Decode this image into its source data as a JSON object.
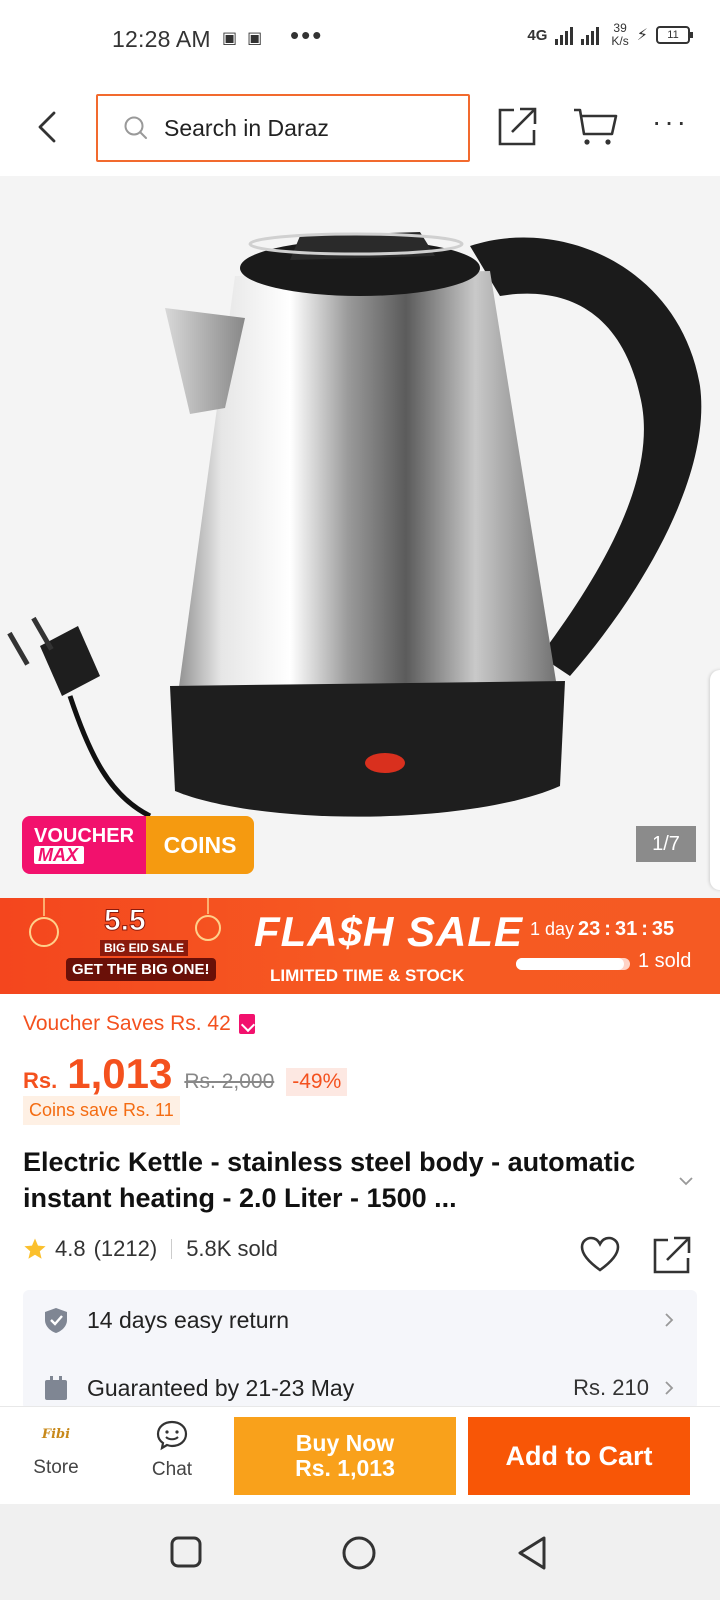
{
  "status_bar": {
    "time": "12:28 AM",
    "network": "4G",
    "speed_value": "39",
    "speed_unit": "K/s",
    "battery": "11"
  },
  "header": {
    "search_placeholder": "Search in Daraz",
    "icons": [
      "back-arrow-icon",
      "search-icon",
      "share-icon",
      "cart-icon",
      "more-icon"
    ]
  },
  "gallery": {
    "counter": "1/7",
    "badge_voucher_line1": "VOUCHER",
    "badge_voucher_line2": "MAX",
    "badge_coins": "COINS"
  },
  "flash_sale": {
    "badge_top": "5.5",
    "badge_mid": "BIG EID SALE",
    "badge_bottom": "GET THE BIG ONE!",
    "title": "FLA$H SALE",
    "subtitle": "LIMITED TIME & STOCK",
    "timer_prefix": "1 day",
    "hours": "23",
    "minutes": "31",
    "seconds": "35",
    "sold": "1 sold",
    "progress": 0.95
  },
  "product": {
    "voucher_saves": "Voucher Saves Rs. 42",
    "currency": "Rs.",
    "price": "1,013",
    "original_price": "Rs. 2,000",
    "discount": "-49%",
    "coins_save": "Coins save Rs. 11",
    "title": "Electric Kettle - stainless steel body - automatic instant heating - 2.0 Liter - 1500 ...",
    "rating": "4.8",
    "rating_count": "(1212)",
    "sold": "5.8K sold"
  },
  "service": {
    "return_text": "14 days easy return",
    "delivery_text": "Guaranteed by 21-23 May",
    "delivery_fee": "Rs. 210"
  },
  "action_bar": {
    "store_logo": "Fibi",
    "store_label": "Store",
    "chat_label": "Chat",
    "buy_now_line1": "Buy Now",
    "buy_now_line2": "Rs. 1,013",
    "add_to_cart": "Add to Cart"
  },
  "colors": {
    "accent": "#f85606",
    "buy_now": "#f9a11b",
    "price": "#f4511e",
    "voucher_pink": "#f2116d"
  }
}
